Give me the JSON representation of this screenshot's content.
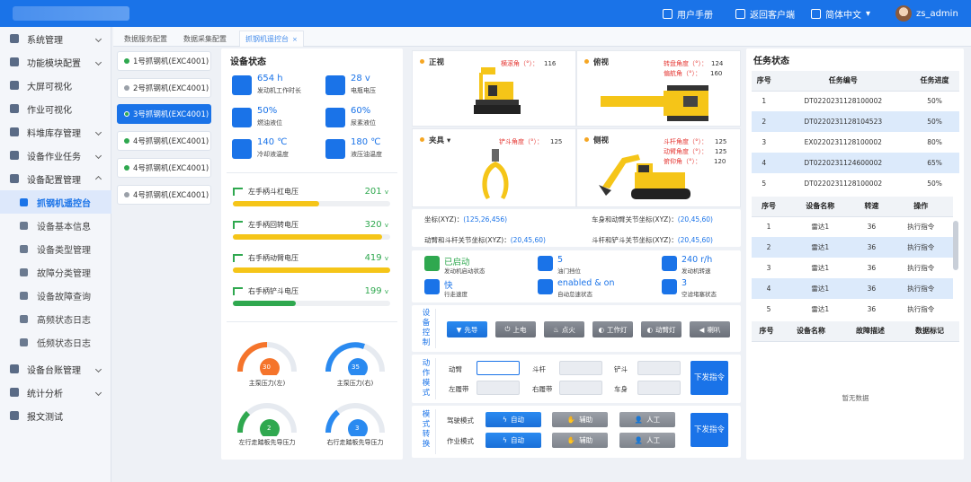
{
  "topbar": {
    "manual": "用户手册",
    "back_client": "返回客户端",
    "language": "简体中文",
    "user": "zs_admin"
  },
  "sidebar": {
    "items": [
      {
        "label": "系统管理"
      },
      {
        "label": "功能模块配置"
      },
      {
        "label": "大屏可视化"
      },
      {
        "label": "作业可视化"
      },
      {
        "label": "料堆库存管理"
      },
      {
        "label": "设备作业任务"
      },
      {
        "label": "设备配置管理"
      }
    ],
    "subitems": [
      {
        "label": "抓钢机遥控台"
      },
      {
        "label": "设备基本信息"
      },
      {
        "label": "设备类型管理"
      },
      {
        "label": "故障分类管理"
      },
      {
        "label": "设备故障查询"
      },
      {
        "label": "高频状态日志"
      },
      {
        "label": "低频状态日志"
      }
    ],
    "bottom_items": [
      {
        "label": "设备台账管理"
      },
      {
        "label": "统计分析"
      },
      {
        "label": "报文测试"
      }
    ]
  },
  "tabs": [
    {
      "label": "数据服务配置"
    },
    {
      "label": "数据采集配置"
    },
    {
      "label": "抓钢机遥控台"
    }
  ],
  "devices": [
    {
      "label": "1号抓钢机(EXC4001)",
      "color": "#2fa84f"
    },
    {
      "label": "2号抓钢机(EXC4001)",
      "color": "#9aa0a8"
    },
    {
      "label": "3号抓钢机(EXC4001)",
      "color": "#2fa84f"
    },
    {
      "label": "4号抓钢机(EXC4001)",
      "color": "#2fa84f"
    },
    {
      "label": "4号抓钢机(EXC4001)",
      "color": "#2fa84f"
    },
    {
      "label": "4号抓钢机(EXC4001)",
      "color": "#9aa0a8"
    }
  ],
  "device_status": {
    "title": "设备状态",
    "stats": [
      {
        "value": "654 h",
        "label": "发动机工作时长",
        "icon": "clock-icon"
      },
      {
        "value": "28 v",
        "label": "电瓶电压",
        "icon": "battery-icon"
      },
      {
        "value": "50%",
        "label": "燃油液位",
        "icon": "fuel-icon"
      },
      {
        "value": "60%",
        "label": "尿素液位",
        "icon": "urea-icon"
      },
      {
        "value": "140 ℃",
        "label": "冷却液温度",
        "icon": "thermometer-icon"
      },
      {
        "value": "180 ℃",
        "label": "液压油温度",
        "icon": "oil-temp-icon"
      }
    ],
    "voltages": [
      {
        "label": "左手柄斗杠电压",
        "value": "201",
        "unit": "v",
        "level": 0.55,
        "color": "#f5c518"
      },
      {
        "label": "左手柄回转电压",
        "value": "320",
        "unit": "v",
        "level": 0.95,
        "color": "#f5c518"
      },
      {
        "label": "右手柄动臂电压",
        "value": "419",
        "unit": "v",
        "level": 1.0,
        "color": "#f5c518"
      },
      {
        "label": "右手柄铲斗电压",
        "value": "199",
        "unit": "v",
        "level": 0.4,
        "color": "#2fa84f"
      }
    ],
    "gauges": [
      {
        "value": "30",
        "label": "主泵压力(左)",
        "color": "#f5742b"
      },
      {
        "value": "35",
        "label": "主泵压力(右)",
        "color": "#2a8af0"
      },
      {
        "value": "2",
        "label": "左行走踏板先导压力",
        "color": "#2fa84f"
      },
      {
        "value": "3",
        "label": "右行走踏板先导压力",
        "color": "#2a8af0"
      }
    ]
  },
  "views": {
    "front": {
      "title": "正视",
      "angles": [
        {
          "label": "横滚角（°）：",
          "value": "116"
        }
      ]
    },
    "top": {
      "title": "俯视",
      "angles": [
        {
          "label": "转盘角度（°）：",
          "value": "124"
        },
        {
          "label": "偏航角（°）：",
          "value": "160"
        }
      ]
    },
    "clamp": {
      "title": "夹具",
      "angles": [
        {
          "label": "铲斗角度（°）：",
          "value": "125"
        }
      ]
    },
    "side": {
      "title": "侧视",
      "angles": [
        {
          "label": "斗杆角度（°）：",
          "value": "125"
        },
        {
          "label": "动臂角度（°）：",
          "value": "125"
        },
        {
          "label": "俯仰角（°）：",
          "value": "120"
        }
      ]
    }
  },
  "coords": [
    {
      "label": "坐标(XYZ)：",
      "value": "(125,26,456)"
    },
    {
      "label": "车身和动臂关节坐标(XYZ)：",
      "value": "(20,45,60)"
    },
    {
      "label": "动臂和斗杆关节坐标(XYZ)：",
      "value": "(20,45,60)"
    },
    {
      "label": "斗杆和铲斗关节坐标(XYZ)：",
      "value": "(20,45,60)"
    }
  ],
  "machine_state": [
    {
      "value": "已启动",
      "label": "发动机启动状态",
      "color": "#2fa84f"
    },
    {
      "value": "5",
      "label": "油门挡位",
      "color": "#1a73e8"
    },
    {
      "value": "240 r/h",
      "label": "发动机转速",
      "color": "#1a73e8"
    },
    {
      "value": "快",
      "label": "行走速度",
      "color": "#1a73e8"
    },
    {
      "value": "enabled & on",
      "label": "自动怠速状态",
      "color": "#1a73e8"
    },
    {
      "value": "3",
      "label": "空滤堵塞状态",
      "color": "#1a73e8"
    }
  ],
  "device_control": {
    "label": "设备控制",
    "buttons": [
      {
        "label": "先导",
        "on": true
      },
      {
        "label": "上电",
        "on": false
      },
      {
        "label": "点火",
        "on": false
      },
      {
        "label": "工作灯",
        "on": false
      },
      {
        "label": "动臂灯",
        "on": false
      },
      {
        "label": "喇叭",
        "on": false
      }
    ]
  },
  "action_mode": {
    "label": "动作模式",
    "fields": [
      {
        "label": "动臂"
      },
      {
        "label": "斗杆"
      },
      {
        "label": "铲斗"
      },
      {
        "label": "左履带"
      },
      {
        "label": "右履带"
      },
      {
        "label": "车身"
      }
    ],
    "send": "下发指令"
  },
  "mode_switch": {
    "label": "模式转换",
    "rows": [
      {
        "label": "驾驶模式",
        "options": [
          "自动",
          "辅助",
          "人工"
        ]
      },
      {
        "label": "作业模式",
        "options": [
          "自动",
          "辅助",
          "人工"
        ]
      }
    ],
    "send": "下发指令"
  },
  "task_status": {
    "title": "任务状态",
    "columns": [
      "序号",
      "任务编号",
      "任务进度"
    ],
    "rows": [
      [
        "1",
        "DT0220231128100002",
        "50%"
      ],
      [
        "2",
        "DT0220231128104523",
        "50%"
      ],
      [
        "3",
        "EX0220231128100002",
        "80%"
      ],
      [
        "4",
        "DT0220231124600002",
        "65%"
      ],
      [
        "5",
        "DT0220231128100002",
        "50%"
      ]
    ]
  },
  "device_table": {
    "columns": [
      "序号",
      "设备名称",
      "转速",
      "操作"
    ],
    "rows": [
      [
        "1",
        "雷达1",
        "36",
        "执行指令"
      ],
      [
        "2",
        "雷达1",
        "36",
        "执行指令"
      ],
      [
        "3",
        "雷达1",
        "36",
        "执行指令"
      ],
      [
        "4",
        "雷达1",
        "36",
        "执行指令"
      ],
      [
        "5",
        "雷达1",
        "36",
        "执行指令"
      ]
    ]
  },
  "fault_table": {
    "columns": [
      "序号",
      "设备名称",
      "故障描述",
      "数据标记"
    ],
    "empty": "暂无数据"
  }
}
